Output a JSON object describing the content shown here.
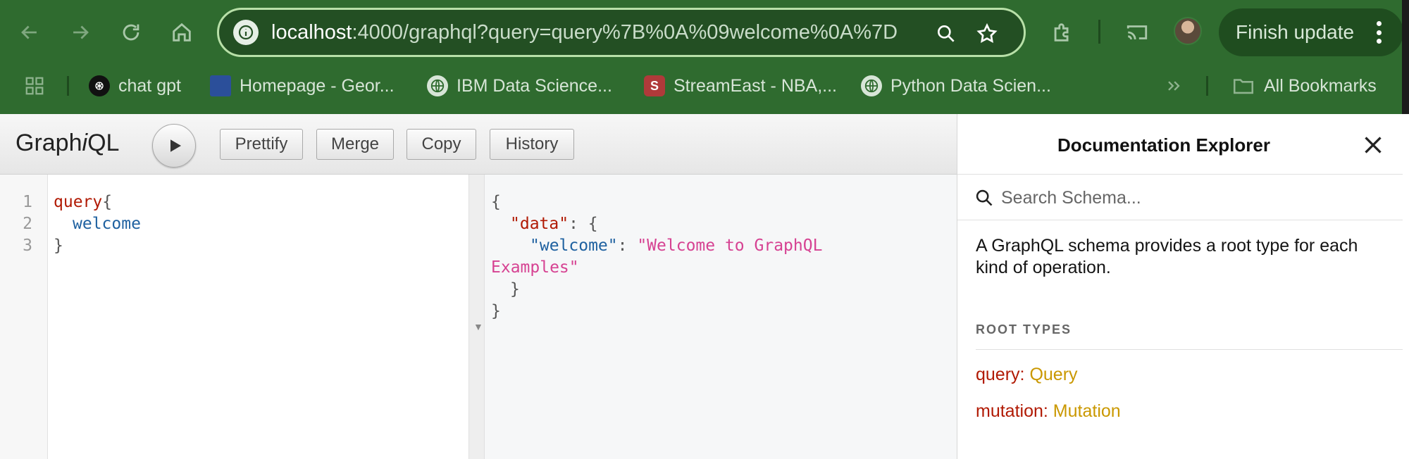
{
  "browser": {
    "url_host": "localhost",
    "url_rest": ":4000/graphql?query=query%7B%0A%09welcome%0A%7D",
    "finish_update_label": "Finish update",
    "bookmarks": [
      {
        "label": "chat gpt"
      },
      {
        "label": "Homepage - Geor..."
      },
      {
        "label": "IBM Data Science..."
      },
      {
        "label": "StreamEast - NBA,..."
      },
      {
        "label": "Python Data Scien..."
      }
    ],
    "all_bookmarks_label": "All Bookmarks",
    "colors": {
      "chrome_bg": "#2f6b2f",
      "omnibox_border": "#b8e0a8"
    }
  },
  "graphiql": {
    "logo_prefix": "Graph",
    "logo_i": "i",
    "logo_suffix": "QL",
    "toolbar": {
      "prettify": "Prettify",
      "merge": "Merge",
      "copy": "Copy",
      "history": "History"
    },
    "editor": {
      "line_numbers": [
        "1",
        "2",
        "3"
      ],
      "line1_keyword": "query",
      "line1_brace": "{",
      "line2_field": "welcome",
      "line3_brace": "}"
    },
    "result": {
      "open_brace": "{",
      "data_key": "\"data\"",
      "colon_brace": ": {",
      "welcome_key": "\"welcome\"",
      "colon": ": ",
      "welcome_value_part1": "\"Welcome to GraphQL",
      "welcome_value_part2": "Examples\"",
      "inner_close": "}",
      "outer_close": "}"
    }
  },
  "docs": {
    "title": "Documentation Explorer",
    "search_placeholder": "Search Schema...",
    "description": "A GraphQL schema provides a root type for each kind of operation.",
    "root_types_label": "ROOT TYPES",
    "root_types": [
      {
        "key": "query",
        "type": "Query"
      },
      {
        "key": "mutation",
        "type": "Mutation"
      }
    ]
  }
}
